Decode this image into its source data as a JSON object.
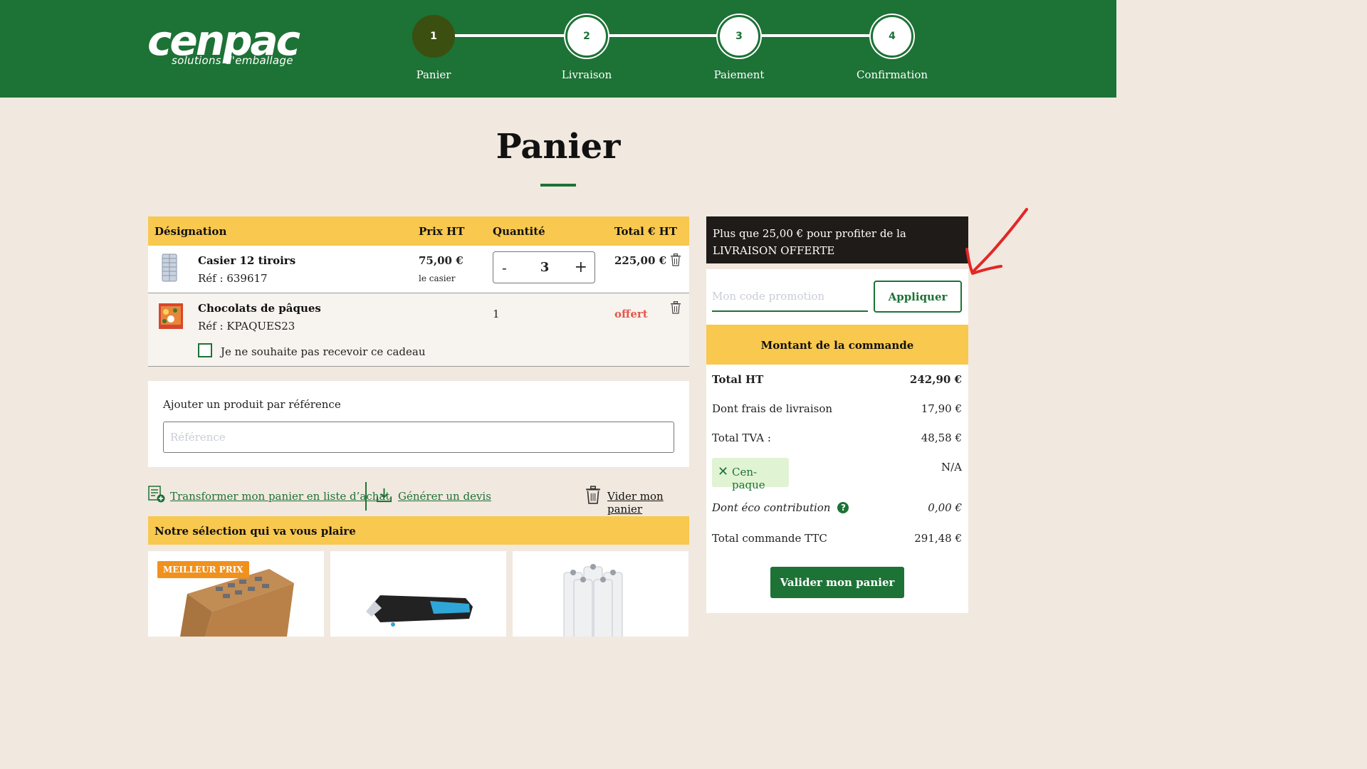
{
  "brand": {
    "logo_main": "cenpac",
    "logo_sub": "solutions d'emballage"
  },
  "steps": [
    {
      "number": "1",
      "label": "Panier"
    },
    {
      "number": "2",
      "label": "Livraison"
    },
    {
      "number": "3",
      "label": "Paiement"
    },
    {
      "number": "4",
      "label": "Confirmation"
    }
  ],
  "page_title": "Panier",
  "cart": {
    "headers": {
      "designation": "Désignation",
      "price": "Prix HT",
      "quantity": "Quantité",
      "total": "Total € HT"
    },
    "items": [
      {
        "name": "Casier 12 tiroirs",
        "ref": "Réf : 639617",
        "price": "75,00 €",
        "unit": "le casier",
        "qty_minus": "-",
        "qty": "3",
        "qty_plus": "+",
        "total": "225,00 €"
      },
      {
        "name": "Chocolats de pâques",
        "ref": "Réf : KPAQUES23",
        "qty": "1",
        "total": "offert",
        "gift_checkbox_label": "Je ne souhaite pas recevoir ce cadeau"
      }
    ]
  },
  "add_ref": {
    "label": "Ajouter un produit par référence",
    "placeholder": "Référence"
  },
  "actions": {
    "to_list": "Transformer mon panier en liste d’achat",
    "quote": "Générer un devis",
    "empty": "Vider mon panier"
  },
  "selection": {
    "title": "Notre sélection qui va vous plaire",
    "badge": "MEILLEUR PRIX"
  },
  "sidebar": {
    "promo_banner": "Plus que 25,00 € pour profiter de la LIVRAISON OFFERTE",
    "promo_placeholder": "Mon code promotion",
    "apply_label": "Appliquer",
    "amount_title": "Montant de la commande",
    "total_ht_label": "Total HT",
    "total_ht": "242,90 €",
    "shipping_label": "Dont frais de livraison",
    "shipping": "17,90 €",
    "tva_label": "Total TVA :",
    "tva": "48,58 €",
    "cenpaque_label": "Cen-paque",
    "cenpaque_value": "N/A",
    "eco_label": "Dont éco contribution",
    "eco_help": "?",
    "eco_value": "0,00 €",
    "ttc_label": "Total commande TTC",
    "ttc": "291,48 €",
    "validate_label": "Valider mon panier"
  },
  "colors": {
    "primary_green": "#1d7236",
    "accent_yellow": "#f8c84f",
    "background": "#f1e8df",
    "annotation_red": "#e32626",
    "badge_orange": "#f0911e"
  }
}
